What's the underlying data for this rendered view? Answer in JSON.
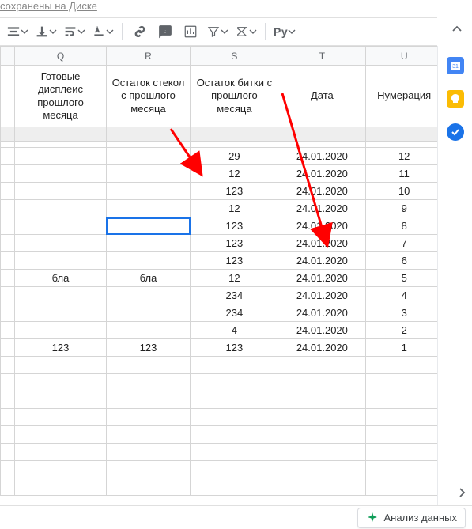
{
  "header": {
    "saved_text": "сохранены на Диске"
  },
  "toolbar": {
    "functions_label": "Py"
  },
  "columns": {
    "P": "",
    "Q": "Q",
    "R": "R",
    "S": "S",
    "T": "T",
    "U": "U"
  },
  "headers": {
    "Q": "Готовые дисплеис прошлого месяца",
    "R": "Остаток стекол с прошлого месяца",
    "S": "Остаток битки с прошлого месяца",
    "T": "Дата",
    "U": "Нумерация"
  },
  "rows": [
    {
      "Q": "",
      "R": "",
      "S": "29",
      "T": "24.01.2020",
      "U": "12"
    },
    {
      "Q": "",
      "R": "",
      "S": "12",
      "T": "24.01.2020",
      "U": "11"
    },
    {
      "Q": "",
      "R": "",
      "S": "123",
      "T": "24.01.2020",
      "U": "10"
    },
    {
      "Q": "",
      "R": "",
      "S": "12",
      "T": "24.01.2020",
      "U": "9"
    },
    {
      "Q": "",
      "R": "",
      "S": "123",
      "T": "24.01.2020",
      "U": "8",
      "sel": "R"
    },
    {
      "Q": "",
      "R": "",
      "S": "123",
      "T": "24.01.2020",
      "U": "7"
    },
    {
      "Q": "",
      "R": "",
      "S": "123",
      "T": "24.01.2020",
      "U": "6"
    },
    {
      "Q": "бла",
      "R": "бла",
      "S": "12",
      "T": "24.01.2020",
      "U": "5"
    },
    {
      "Q": "",
      "R": "",
      "S": "234",
      "T": "24.01.2020",
      "U": "4"
    },
    {
      "Q": "",
      "R": "",
      "S": "234",
      "T": "24.01.2020",
      "U": "3"
    },
    {
      "Q": "",
      "R": "",
      "S": "4",
      "T": "24.01.2020",
      "U": "2"
    },
    {
      "Q": "123",
      "R": "123",
      "S": "123",
      "T": "24.01.2020",
      "U": "1"
    }
  ],
  "bottom": {
    "explore_label": "Анализ данных"
  },
  "chart_data": {
    "type": "table",
    "title": "",
    "columns": [
      "Готовые дисплеис прошлого месяца",
      "Остаток стекол с прошлого месяца",
      "Остаток битки с прошлого месяца",
      "Дата",
      "Нумерация"
    ],
    "rows": [
      [
        "",
        "",
        "29",
        "24.01.2020",
        "12"
      ],
      [
        "",
        "",
        "12",
        "24.01.2020",
        "11"
      ],
      [
        "",
        "",
        "123",
        "24.01.2020",
        "10"
      ],
      [
        "",
        "",
        "12",
        "24.01.2020",
        "9"
      ],
      [
        "",
        "",
        "123",
        "24.01.2020",
        "8"
      ],
      [
        "",
        "",
        "123",
        "24.01.2020",
        "7"
      ],
      [
        "",
        "",
        "123",
        "24.01.2020",
        "6"
      ],
      [
        "бла",
        "бла",
        "12",
        "24.01.2020",
        "5"
      ],
      [
        "",
        "",
        "234",
        "24.01.2020",
        "4"
      ],
      [
        "",
        "",
        "234",
        "24.01.2020",
        "3"
      ],
      [
        "",
        "",
        "4",
        "24.01.2020",
        "2"
      ],
      [
        "123",
        "123",
        "123",
        "24.01.2020",
        "1"
      ]
    ]
  }
}
